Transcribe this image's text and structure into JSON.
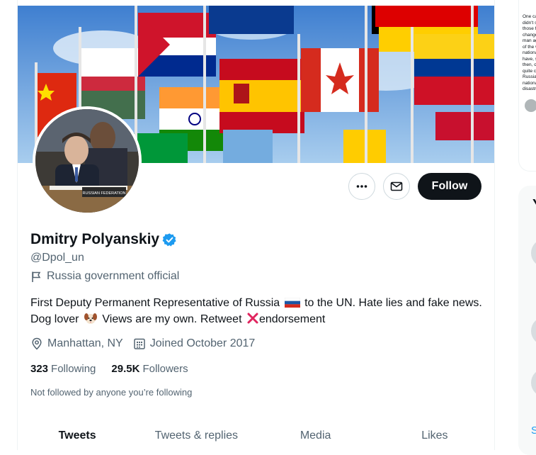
{
  "profile": {
    "display_name": "Dmitry Polyanskiy",
    "handle": "@Dpol_un",
    "category": "Russia government official",
    "bio": {
      "part1": "First Deputy Permanent Representative of Russia",
      "part2": "to the UN. Hate lies and fake news. Dog lover",
      "part3": "Views are my own. Retweet",
      "part4": "endorsement"
    },
    "location": "Manhattan, NY",
    "joined": "Joined October 2017",
    "following_count": "323",
    "following_label": "Following",
    "followers_count": "29.5K",
    "followers_label": "Followers",
    "not_followed": "Not followed by anyone you’re following"
  },
  "actions": {
    "follow_label": "Follow"
  },
  "tabs": [
    {
      "label": "Tweets",
      "active": true
    },
    {
      "label": "Tweets & replies",
      "active": false
    },
    {
      "label": "Media",
      "active": false
    },
    {
      "label": "Likes",
      "active": false
    }
  ],
  "avatar_caption": "RUSSIAN FEDERATION",
  "sidebar": {
    "snippet_lines": [
      "One ca",
      "didn't s",
      "those f",
      "change",
      "man ag",
      "of the w",
      "nationa",
      "have, s",
      "then, c",
      "quite c",
      "Russia",
      "nationa",
      "disastr"
    ],
    "panel_title": "Y",
    "panel_link": "S"
  },
  "colors": {
    "accent": "#1d9bf0",
    "text_primary": "#0f1419",
    "text_secondary": "#536471",
    "follow_bg": "#0f1419"
  }
}
